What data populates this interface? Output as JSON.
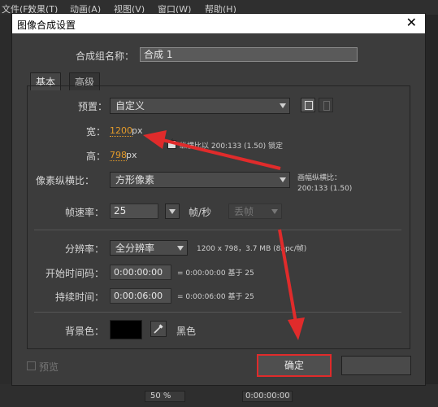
{
  "app_menu": [
    "文件(F)",
    "效果(T)",
    "动画(A)",
    "视图(V)",
    "窗口(W)",
    "帮助(H)"
  ],
  "dialog": {
    "title": "图像合成设置",
    "name_label": "合成组名称：",
    "name_value": "合成 1",
    "tabs": [
      "基本",
      "高级"
    ],
    "preset_label": "预置：",
    "preset_value": "自定义",
    "width_label": "宽：",
    "width_value": "1200",
    "width_unit": "px",
    "lock_text": "纵横比以 200:133 (1.50) 锁定",
    "height_label": "高：",
    "height_value": "798",
    "height_unit": "px",
    "pixel_aspect_label": "像素纵横比：",
    "pixel_aspect_value": "方形像素",
    "frame_aspect_label": "画幅纵横比：",
    "frame_aspect_value": "200:133 (1.50)",
    "fps_label": "帧速率：",
    "fps_value": "25",
    "fps_unit": "帧/秒",
    "drop_frame": "丢帧",
    "resolution_label": "分辨率：",
    "resolution_value": "全分辨率",
    "resolution_info": "1200 x 798，3.7 MB (8bpc/帧)",
    "start_label": "开始时间码：",
    "start_value": "0:00:00:00",
    "start_info": "= 0:00:00:00  基于 25",
    "duration_label": "持续时间：",
    "duration_value": "0:00:06:00",
    "duration_info": "= 0:00:06:00  基于 25",
    "bg_label": "背景色：",
    "bg_color_name": "黑色",
    "preview_label": "预览",
    "ok_label": "确定"
  },
  "status": {
    "zoom": "50 %",
    "timecode": "0:00:00:00"
  },
  "colors": {
    "annotation": "#e02b2b",
    "accent_value": "#e39a2a"
  }
}
